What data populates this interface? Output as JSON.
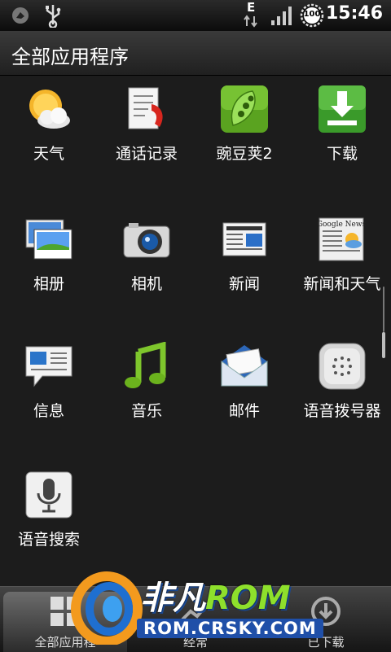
{
  "statusbar": {
    "time": "15:46",
    "battery": "100",
    "network": "E",
    "icons": [
      "notification-icon",
      "usb-icon",
      "data-arrows-icon",
      "signal-icon",
      "battery-icon"
    ]
  },
  "header": {
    "title": "全部应用程序"
  },
  "apps": [
    {
      "label": "天气",
      "icon": "weather-icon"
    },
    {
      "label": "通话记录",
      "icon": "call-log-icon"
    },
    {
      "label": "豌豆荚2",
      "icon": "wandoujia-icon"
    },
    {
      "label": "下载",
      "icon": "download-icon"
    },
    {
      "label": "相册",
      "icon": "gallery-icon"
    },
    {
      "label": "相机",
      "icon": "camera-icon"
    },
    {
      "label": "新闻",
      "icon": "news-icon"
    },
    {
      "label": "新闻和天气",
      "icon": "news-weather-icon"
    },
    {
      "label": "信息",
      "icon": "messages-icon"
    },
    {
      "label": "音乐",
      "icon": "music-icon"
    },
    {
      "label": "邮件",
      "icon": "mail-icon"
    },
    {
      "label": "语音拨号器",
      "icon": "voice-dialer-icon"
    },
    {
      "label": "语音搜索",
      "icon": "voice-search-icon"
    }
  ],
  "news_weather_icon_text": "Google News",
  "tabs": [
    {
      "label": "全部应用程",
      "icon": "grid-icon",
      "active": true
    },
    {
      "label": "经常",
      "icon": "frequent-icon",
      "active": false
    },
    {
      "label": "已下载",
      "icon": "downloaded-icon",
      "active": false
    }
  ],
  "watermark": {
    "brand_cn": "非凡",
    "brand_rom": "ROM",
    "site": "ROM.CRSKY.COM"
  }
}
